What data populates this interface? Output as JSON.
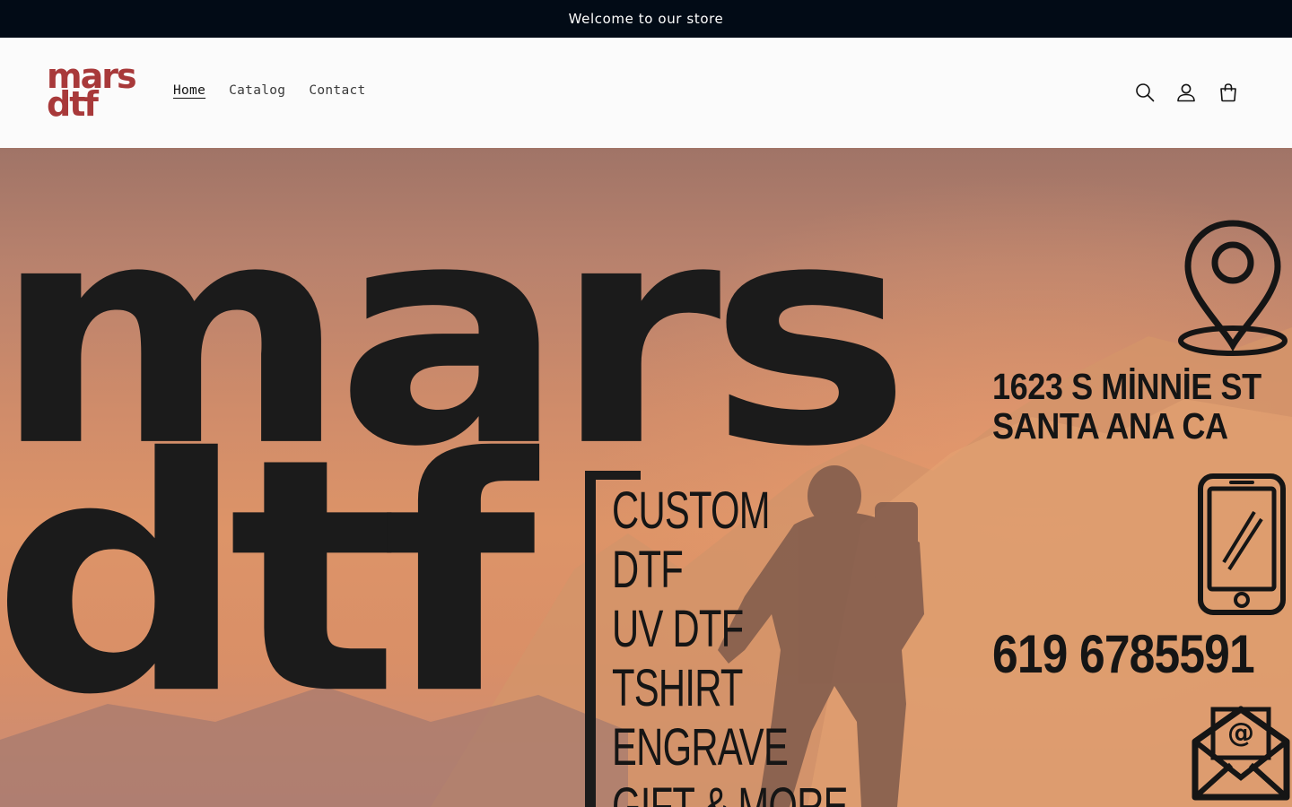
{
  "announcement": {
    "text": "Welcome to our store"
  },
  "header": {
    "logo": {
      "line1": "mars",
      "line2": "dtf"
    },
    "nav": [
      {
        "label": "Home",
        "active": true
      },
      {
        "label": "Catalog",
        "active": false
      },
      {
        "label": "Contact",
        "active": false
      }
    ],
    "icons": [
      "search-icon",
      "account-icon",
      "cart-icon"
    ]
  },
  "hero": {
    "brand_line1": "mars",
    "brand_line2": "dtf",
    "services": [
      "CUSTOM",
      "DTF",
      "UV DTF",
      "TSHIRT",
      "ENGRAVE",
      "GIFT & MORE"
    ],
    "address_line1": "1623 S MİNNİE ST",
    "address_line2": "SANTA ANA CA",
    "phone": "619 6785591",
    "icons": [
      "location-pin-icon",
      "phone-icon",
      "email-icon"
    ]
  },
  "colors": {
    "announcement_bg": "#020b16",
    "logo": "#a8393a",
    "hero_text": "#1b1b1b",
    "hero_bg": "#d08c6a"
  }
}
